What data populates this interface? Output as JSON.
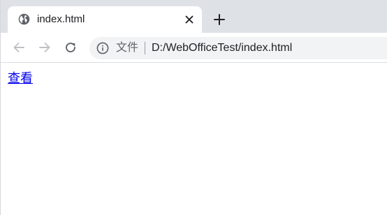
{
  "tab": {
    "title": "index.html",
    "favicon": "globe-icon",
    "close_icon": "close-icon"
  },
  "new_tab_icon": "plus-icon",
  "toolbar": {
    "back_icon": "back-arrow-icon",
    "forward_icon": "forward-arrow-icon",
    "reload_icon": "reload-icon"
  },
  "omnibox": {
    "info_icon": "info-icon",
    "security_label": "文件",
    "url": "D:/WebOfficeTest/index.html"
  },
  "page": {
    "link_text": "查看"
  },
  "colors": {
    "tabstrip_bg": "#dee1e6",
    "omnibox_bg": "#f1f3f4",
    "link": "#0000ee",
    "disabled_icon": "#bdc1c6",
    "icon": "#5f6368"
  }
}
